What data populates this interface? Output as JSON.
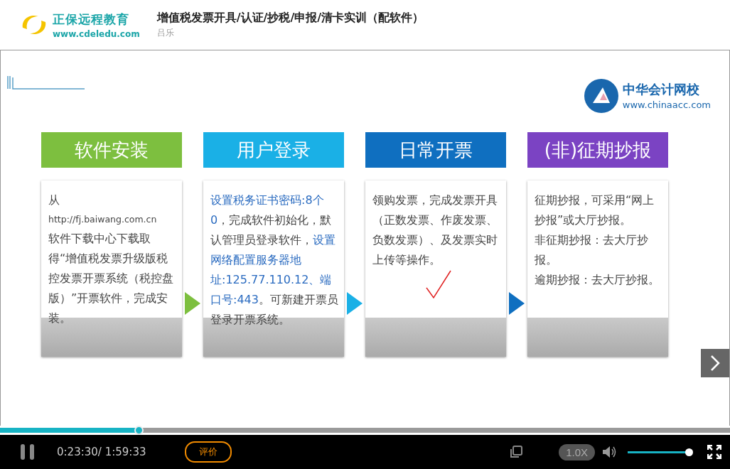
{
  "header": {
    "brand_name": "正保远程教育",
    "brand_url": "www.cdeledu.com",
    "course_title": "增值税发票开具/认证/抄税/申报/清卡实训（配软件）",
    "teacher": "吕乐"
  },
  "slide": {
    "school_name": "中华会计网校",
    "school_url": "www.chinaacc.com",
    "steps": [
      {
        "title": "软件安装",
        "color": "#7dbf3f",
        "segments": [
          {
            "text": "从",
            "highlight": false
          },
          {
            "text": "http://fj.baiwang.com.cn",
            "highlight": false,
            "kind": "url"
          },
          {
            "text": "软件下载中心下载取得“增值税发票升级版税控发票开票系统（税控盘版）”开票软件，完成安装。",
            "highlight": false
          }
        ]
      },
      {
        "title": "用户登录",
        "color": "#1ab0e6",
        "segments": [
          {
            "text": "设置税务证书密码:8个0",
            "highlight": true
          },
          {
            "text": "，完成软件初始化，默认管理员登录软件，",
            "highlight": false
          },
          {
            "text": "设置网络配置服务器地址:125.77.110.12、端口号:443",
            "highlight": true
          },
          {
            "text": "。可新建开票员登录开票系统。",
            "highlight": false
          }
        ]
      },
      {
        "title": "日常开票",
        "color": "#0f6fc0",
        "segments": [
          {
            "text": "领购发票，完成发票开具（正数发票、作废发票、负数发票）、及发票实时上传等操作。",
            "highlight": false
          }
        ]
      },
      {
        "title": "(非)征期抄报",
        "color": "#7b43c3",
        "segments": [
          {
            "text": "征期抄报，可采用“网上抄报”或大厅抄报。",
            "highlight": false
          },
          {
            "text": "非征期抄报：去大厅抄报。",
            "highlight": false
          },
          {
            "text": "逾期抄报：去大厅抄报。",
            "highlight": false
          }
        ]
      }
    ]
  },
  "player": {
    "progress": {
      "level": 0.19
    },
    "time": "0:23:30/ 1:59:33",
    "rate_button": "评价",
    "speed": "1.0X",
    "volume": {
      "level": 1.0
    }
  }
}
